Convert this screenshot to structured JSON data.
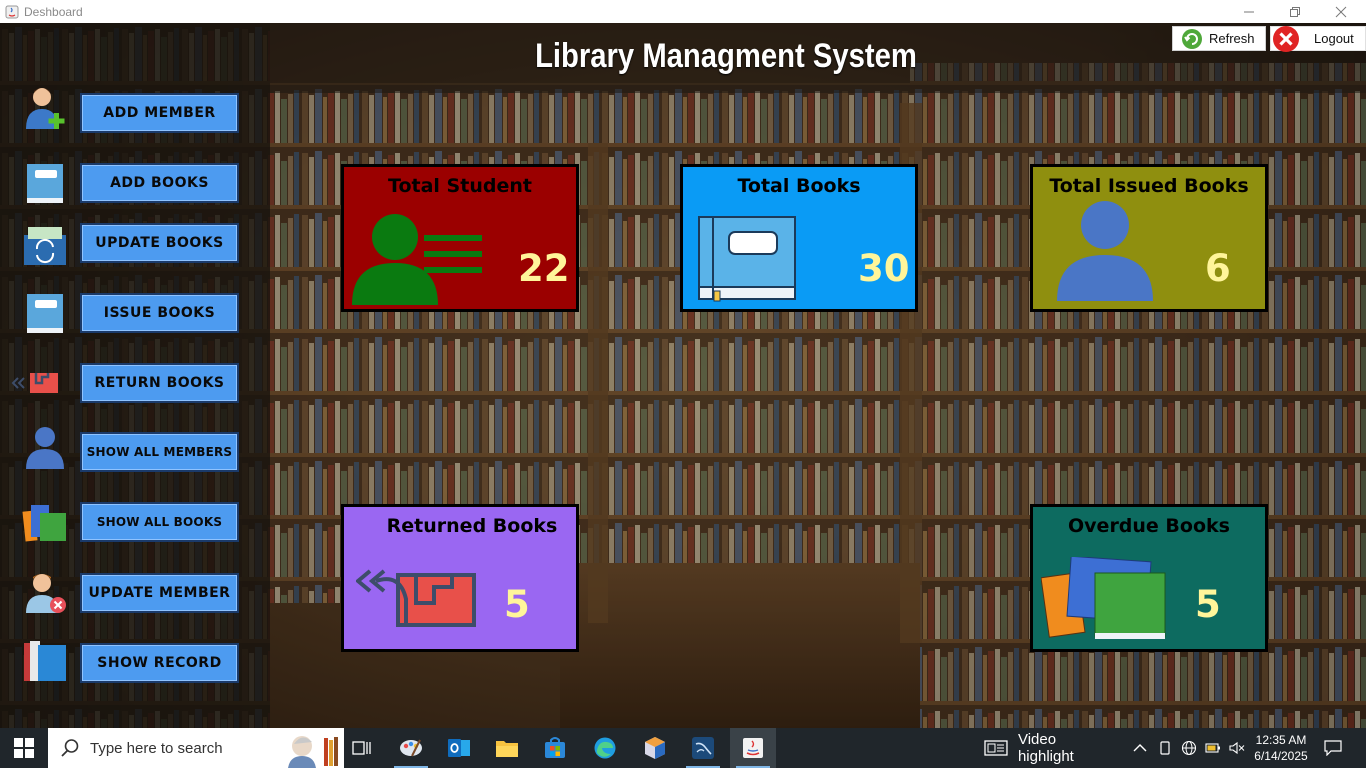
{
  "window": {
    "title": "Deshboard"
  },
  "header": {
    "title": "Library Managment System",
    "refresh_label": "Refresh",
    "logout_label": "Logout"
  },
  "sidebar": {
    "items": [
      {
        "label": "ADD MEMBER",
        "icon": "add-user-icon"
      },
      {
        "label": "ADD BOOKS",
        "icon": "book-icon"
      },
      {
        "label": "UPDATE BOOKS",
        "icon": "update-book-icon"
      },
      {
        "label": "ISSUE BOOKS",
        "icon": "book-icon"
      },
      {
        "label": "RETURN BOOKS",
        "icon": "return-icon"
      },
      {
        "label": "SHOW ALL MEMBERS",
        "icon": "user-icon"
      },
      {
        "label": "SHOW ALL BOOKS",
        "icon": "books-stack-icon"
      },
      {
        "label": "UPDATE MEMBER",
        "icon": "remove-user-icon"
      },
      {
        "label": "SHOW RECORD",
        "icon": "record-book-icon"
      }
    ]
  },
  "cards": {
    "total_student": {
      "title": "Total Student",
      "value": "22",
      "color": "#9b0000",
      "icon": "student-list-icon"
    },
    "total_books": {
      "title": "Total Books",
      "value": "30",
      "color": "#0a9bf5",
      "icon": "book-icon"
    },
    "total_issued": {
      "title": "Total Issued Books",
      "value": "6",
      "color": "#8f8f0f",
      "icon": "user-icon"
    },
    "returned": {
      "title": "Returned Books",
      "value": "5",
      "color": "#9a67f2",
      "icon": "return-icon"
    },
    "overdue": {
      "title": "Overdue Books",
      "value": "5",
      "color": "#0d6b60",
      "icon": "books-stack-icon"
    }
  },
  "taskbar": {
    "search_placeholder": "Type here to search",
    "video_highlight": "Video highlight",
    "time": "12:35 AM",
    "date": "6/14/2025"
  }
}
